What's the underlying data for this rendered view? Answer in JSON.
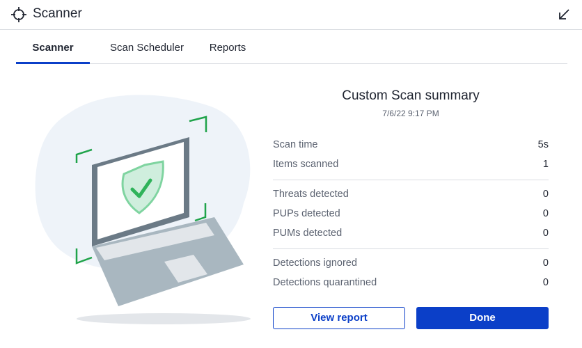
{
  "window": {
    "title": "Scanner",
    "app_icon": "crosshair-icon",
    "minimize_icon": "arrow-down-left-icon"
  },
  "tabs": [
    {
      "label": "Scanner",
      "active": true
    },
    {
      "label": "Scan Scheduler",
      "active": false
    },
    {
      "label": "Reports",
      "active": false
    }
  ],
  "summary": {
    "title": "Custom Scan summary",
    "date": "7/6/22 9:17 PM",
    "stats": [
      {
        "label": "Scan time",
        "value": "5s"
      },
      {
        "label": "Items scanned",
        "value": "1"
      },
      {
        "label": "Threats detected",
        "value": "0"
      },
      {
        "label": "PUPs detected",
        "value": "0"
      },
      {
        "label": "PUMs detected",
        "value": "0"
      },
      {
        "label": "Detections ignored",
        "value": "0"
      },
      {
        "label": "Detections quarantined",
        "value": "0"
      }
    ]
  },
  "buttons": {
    "view_report": "View report",
    "done": "Done"
  },
  "colors": {
    "accent": "#0b3fc8",
    "shield_green": "#2fb35a",
    "frame_green": "#1fa34a",
    "laptop_gray": "#6b7a86"
  }
}
